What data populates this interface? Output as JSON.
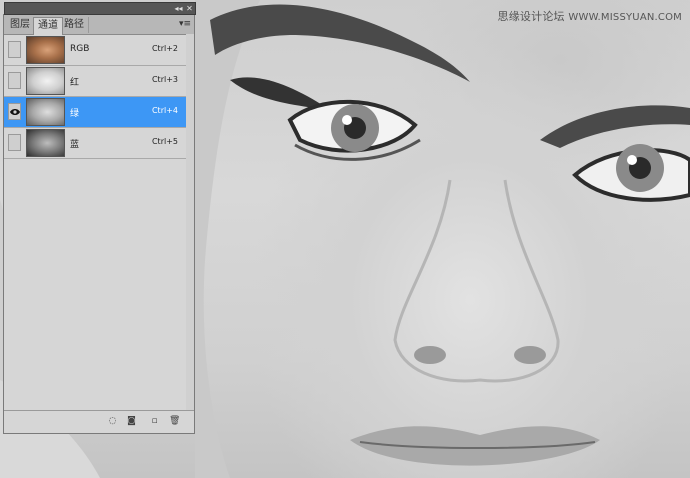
{
  "panel": {
    "tabs": [
      {
        "label": "图层",
        "active": false
      },
      {
        "label": "通道",
        "active": true
      },
      {
        "label": "路径",
        "active": false
      }
    ],
    "menu_icon": "panel-menu-icon",
    "collapse_icon": "collapse-arrows-icon",
    "close_icon": "close-icon",
    "channels": [
      {
        "name": "RGB",
        "shortcut": "Ctrl+2",
        "visible": false,
        "selected": false,
        "thumb": "color"
      },
      {
        "name": "红",
        "shortcut": "Ctrl+3",
        "visible": false,
        "selected": false,
        "thumb": "light"
      },
      {
        "name": "绿",
        "shortcut": "Ctrl+4",
        "visible": true,
        "selected": true,
        "thumb": "mid"
      },
      {
        "name": "蓝",
        "shortcut": "Ctrl+5",
        "visible": false,
        "selected": false,
        "thumb": "dark"
      }
    ],
    "footer_icons": [
      "load-selection-icon",
      "save-selection-icon",
      "new-channel-icon",
      "delete-channel-icon"
    ],
    "selection_color": "#3d97f5"
  },
  "watermark": {
    "text": "思缘设计论坛",
    "url": "WWW.MISSYUAN.COM"
  }
}
